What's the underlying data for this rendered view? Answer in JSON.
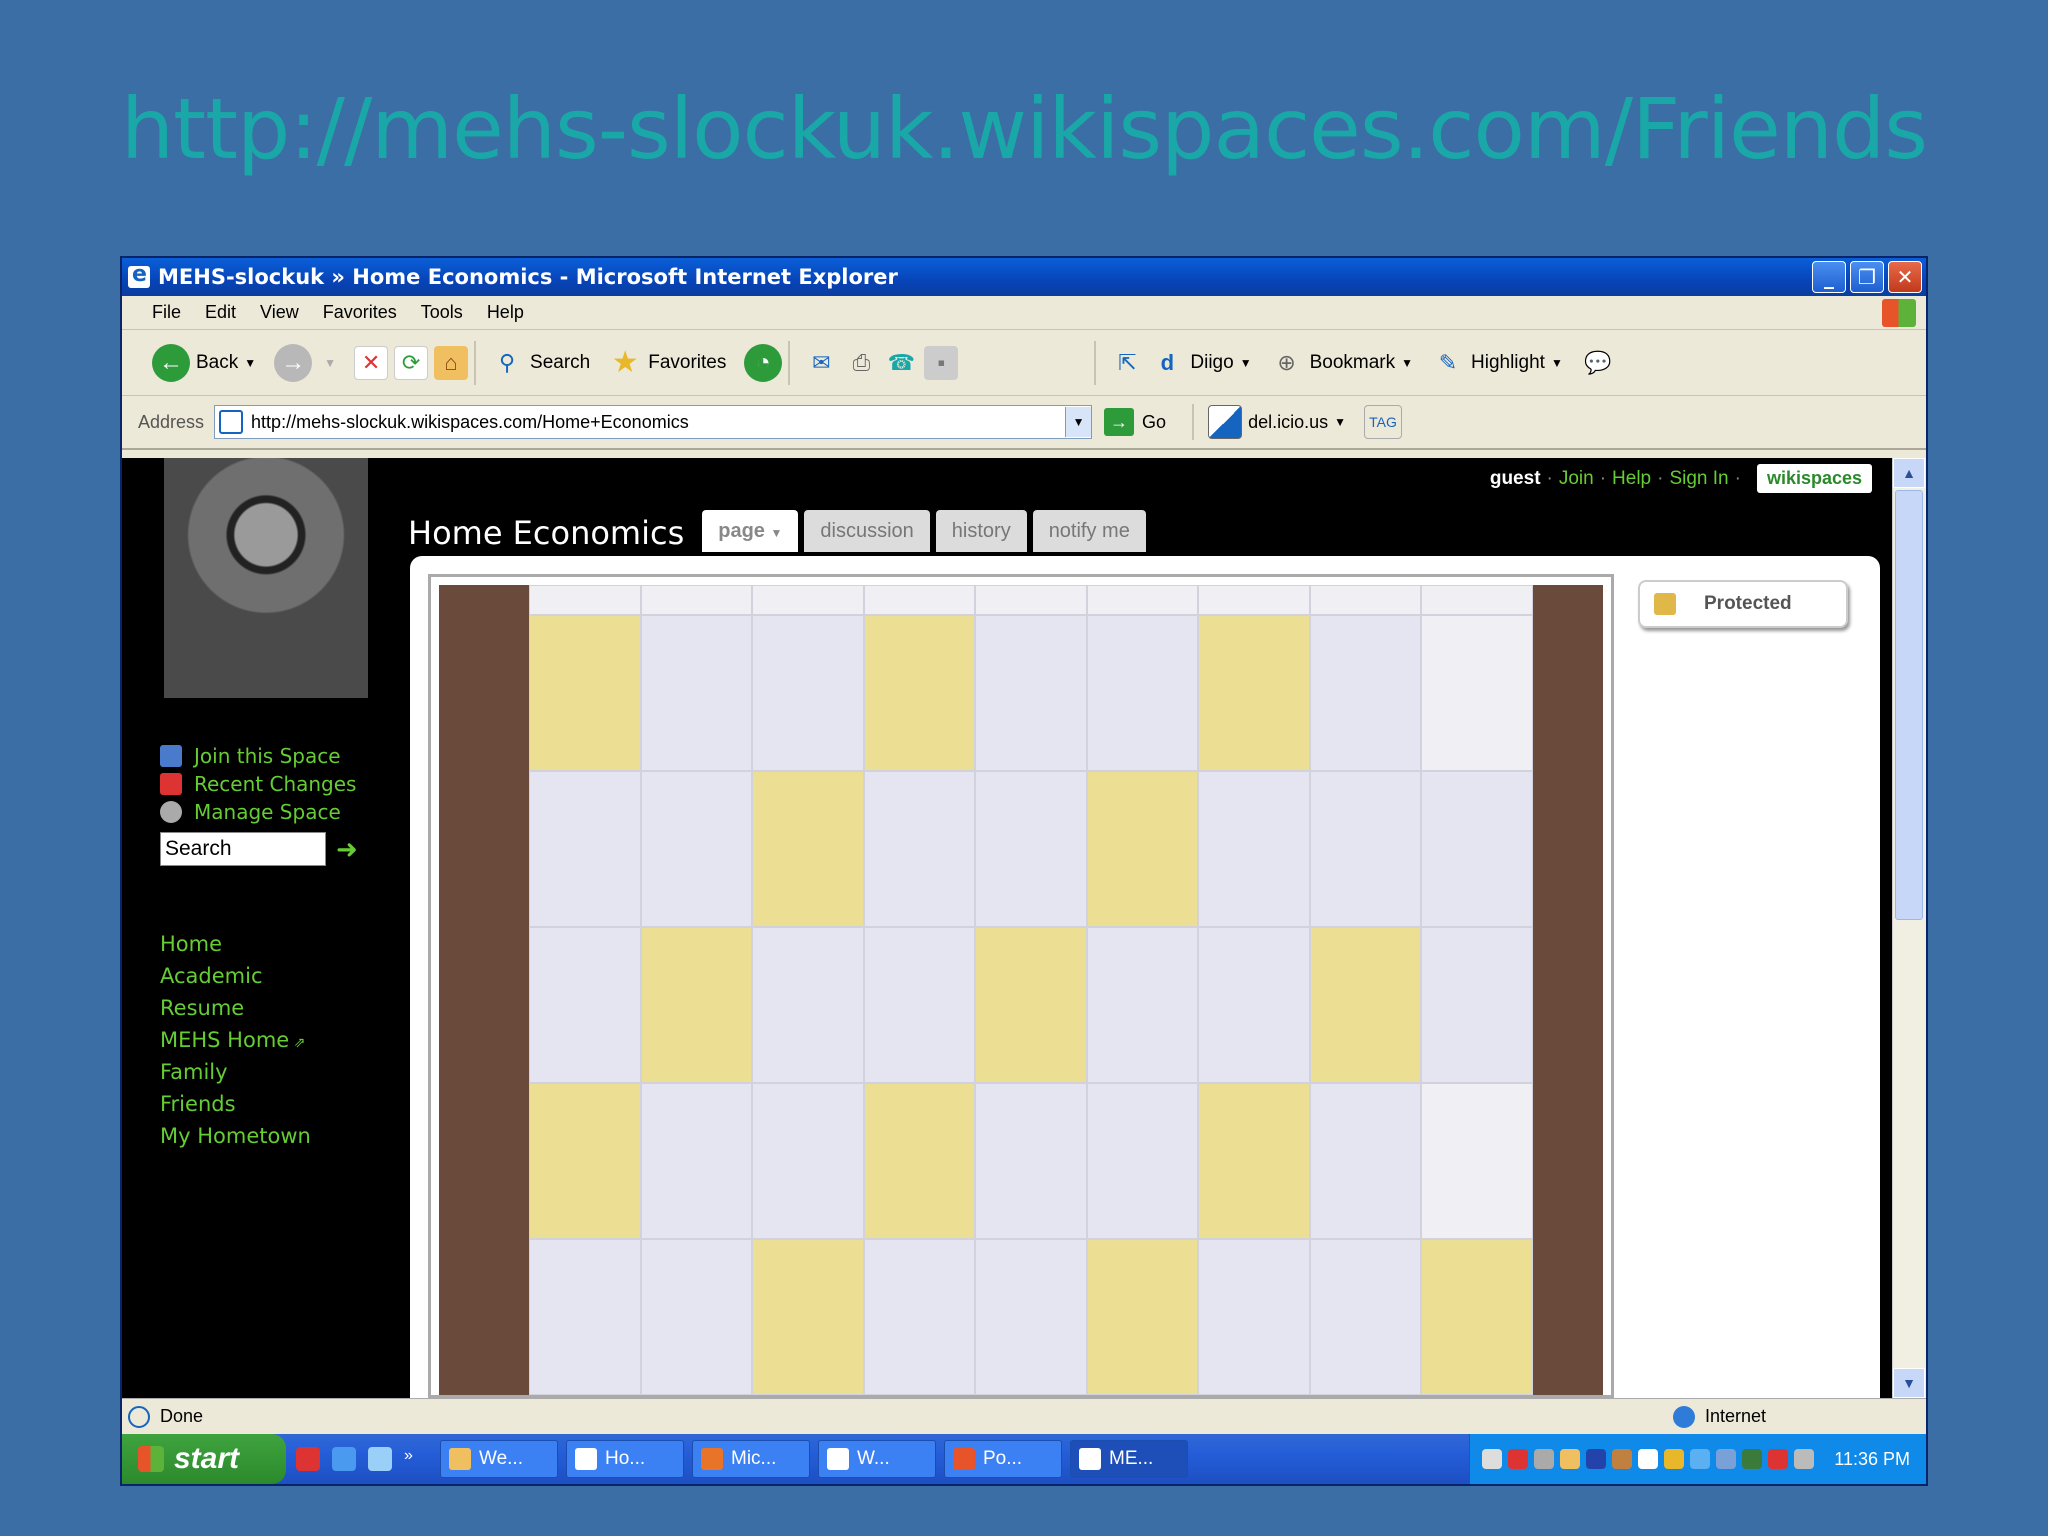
{
  "slide": {
    "title": "http://mehs-slockuk.wikispaces.com/Friends"
  },
  "window": {
    "title": "MEHS-slockuk » Home Economics - Microsoft Internet Explorer",
    "menu": [
      "File",
      "Edit",
      "View",
      "Favorites",
      "Tools",
      "Help"
    ],
    "toolbar": {
      "back": "Back",
      "search": "Search",
      "favorites": "Favorites",
      "diigo": "Diigo",
      "bookmark": "Bookmark",
      "highlight": "Highlight"
    },
    "address": {
      "label": "Address",
      "url": "http://mehs-slockuk.wikispaces.com/Home+Economics",
      "go": "Go",
      "delicious": "del.icio.us",
      "tag": "TAG"
    },
    "status": {
      "text": "Done",
      "zone": "Internet"
    }
  },
  "site": {
    "top_links": {
      "guest": "guest",
      "join": "Join",
      "help": "Help",
      "sign_in": "Sign In",
      "brand": "wikispaces"
    },
    "sidebar_actions": [
      "Join this Space",
      "Recent Changes",
      "Manage Space"
    ],
    "search_placeholder": "Search",
    "nav": [
      "Home",
      "Academic",
      "Resume",
      "MEHS Home",
      "Family",
      "Friends",
      "My Hometown"
    ],
    "page_title": "Home Economics",
    "tabs": [
      "page",
      "discussion",
      "history",
      "notify me"
    ],
    "protected_label": "Protected"
  },
  "taskbar": {
    "start": "start",
    "tasks": [
      "We...",
      "Ho...",
      "Mic...",
      "W...",
      "Po...",
      "ME..."
    ],
    "clock": "11:36 PM"
  },
  "colors": {
    "accent_green": "#66cc33",
    "slide_bg": "#3a6ea5",
    "slide_title": "#1aa7a7"
  }
}
